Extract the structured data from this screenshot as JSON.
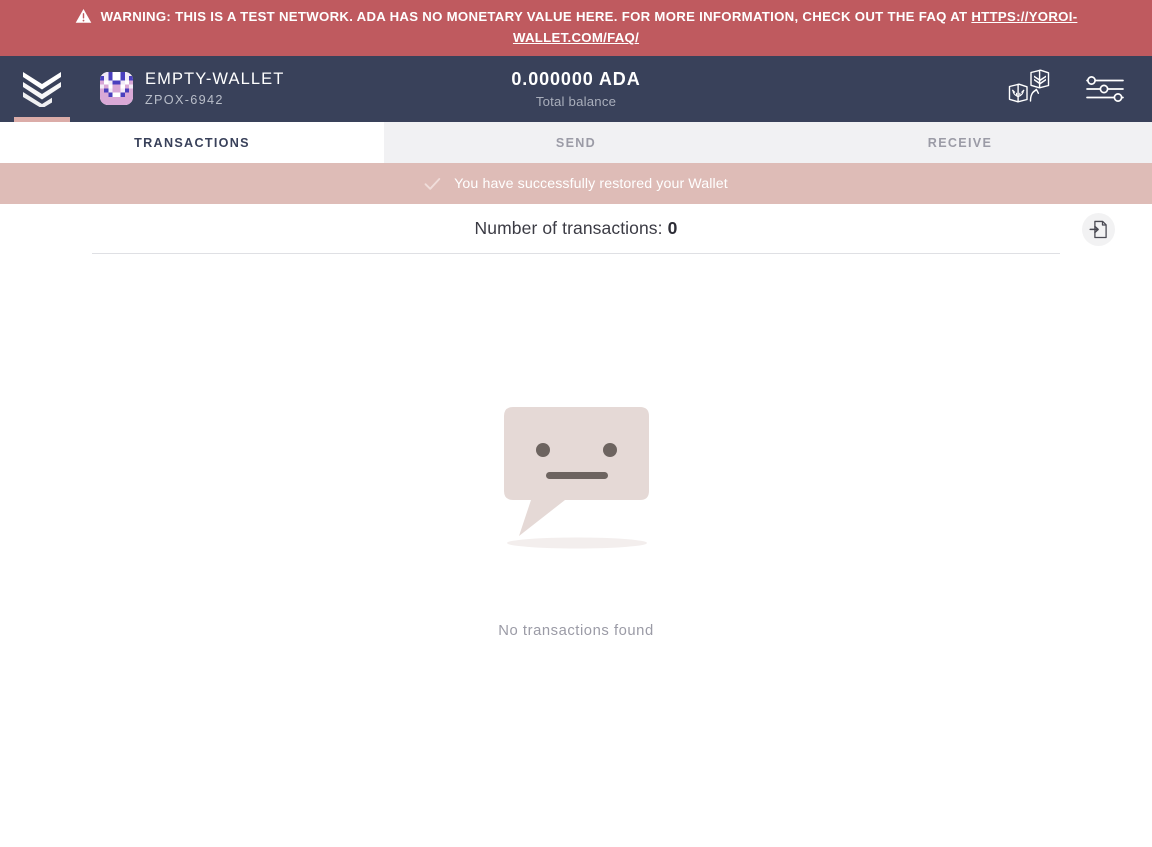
{
  "warning": {
    "icon": "warning-triangle-icon",
    "text": "WARNING: THIS IS A TEST NETWORK. ADA HAS NO MONETARY VALUE HERE. FOR MORE INFORMATION, CHECK OUT THE FAQ AT ",
    "link_text": "HTTPS://YOROI-WALLET.COM/FAQ/",
    "bg_color": "#bf5a5f"
  },
  "topnav": {
    "logo_icon": "yoroi-logo-icon",
    "bg_color": "#39415a",
    "accent_color": "#dbaca8",
    "wallet": {
      "avatar_icon": "wallet-identicon-avatar",
      "name": "EMPTY-WALLET",
      "plate": "ZPOX-6942"
    },
    "balance": {
      "amount": "0.000000 ADA",
      "label": "Total balance"
    },
    "actions": [
      {
        "name": "wallet-switch-icon",
        "label": "Switch wallet"
      },
      {
        "name": "settings-sliders-icon",
        "label": "Settings"
      }
    ]
  },
  "tabs": [
    {
      "label": "Transactions",
      "name": "tab-transactions",
      "active": true
    },
    {
      "label": "Send",
      "name": "tab-send",
      "active": false
    },
    {
      "label": "Receive",
      "name": "tab-receive",
      "active": false
    }
  ],
  "notification": {
    "icon": "check-icon",
    "message": "You have successfully restored your Wallet",
    "bg_color": "#debcb7"
  },
  "transactions": {
    "count_label": "Number of transactions:",
    "count_value": "0",
    "export_icon": "export-document-icon",
    "empty_illustration": "speech-bubble-neutral-face-icon",
    "empty_text": "No transactions found"
  }
}
